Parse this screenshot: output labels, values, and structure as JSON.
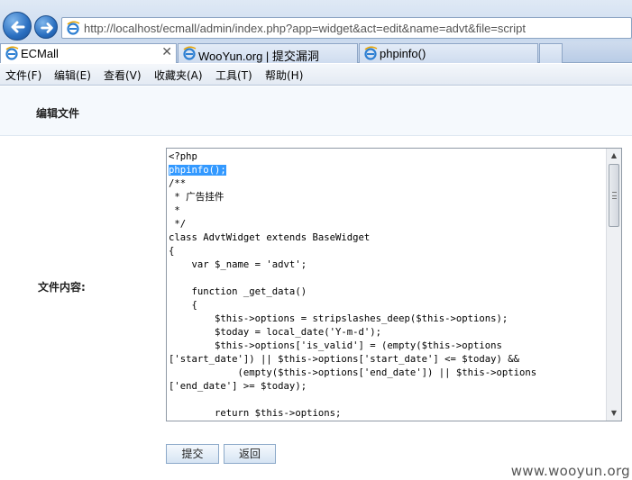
{
  "browser": {
    "address_url": "http://localhost/ecmall/admin/index.php?app=widget&act=edit&name=advt&file=script",
    "tabs": [
      {
        "label": "ECMall",
        "active": true
      },
      {
        "label": "WooYun.org | 提交漏洞",
        "active": false
      },
      {
        "label": "phpinfo()",
        "active": false
      }
    ],
    "tab_close": "✕",
    "menu": [
      "文件(F)",
      "编辑(E)",
      "查看(V)",
      "收藏夹(A)",
      "工具(T)",
      "帮助(H)"
    ]
  },
  "page": {
    "title": "编辑文件",
    "field_label": "文件内容:",
    "code_lines": [
      {
        "text": "<?php"
      },
      {
        "text": "phpinfo();",
        "selected": true
      },
      {
        "text": "/**"
      },
      {
        "text": " * 广告挂件"
      },
      {
        "text": " *"
      },
      {
        "text": " */"
      },
      {
        "text": "class AdvtWidget extends BaseWidget"
      },
      {
        "text": "{"
      },
      {
        "text": "    var $_name = 'advt';"
      },
      {
        "text": ""
      },
      {
        "text": "    function _get_data()"
      },
      {
        "text": "    {"
      },
      {
        "text": "        $this->options = stripslashes_deep($this->options);"
      },
      {
        "text": "        $today = local_date('Y-m-d');"
      },
      {
        "text": "        $this->options['is_valid'] = (empty($this->options"
      },
      {
        "text": "['start_date']) || $this->options['start_date'] <= $today) &&"
      },
      {
        "text": "            (empty($this->options['end_date']) || $this->options"
      },
      {
        "text": "['end_date'] >= $today);"
      },
      {
        "text": ""
      },
      {
        "text": "        return $this->options;"
      }
    ],
    "submit_label": "提交",
    "back_label": "返回"
  },
  "watermark": "www.wooyun.org",
  "colors": {
    "selection": "#3399ff",
    "page_header_bg": "#f5f9fd",
    "chrome_bg": "#cfdcee"
  }
}
